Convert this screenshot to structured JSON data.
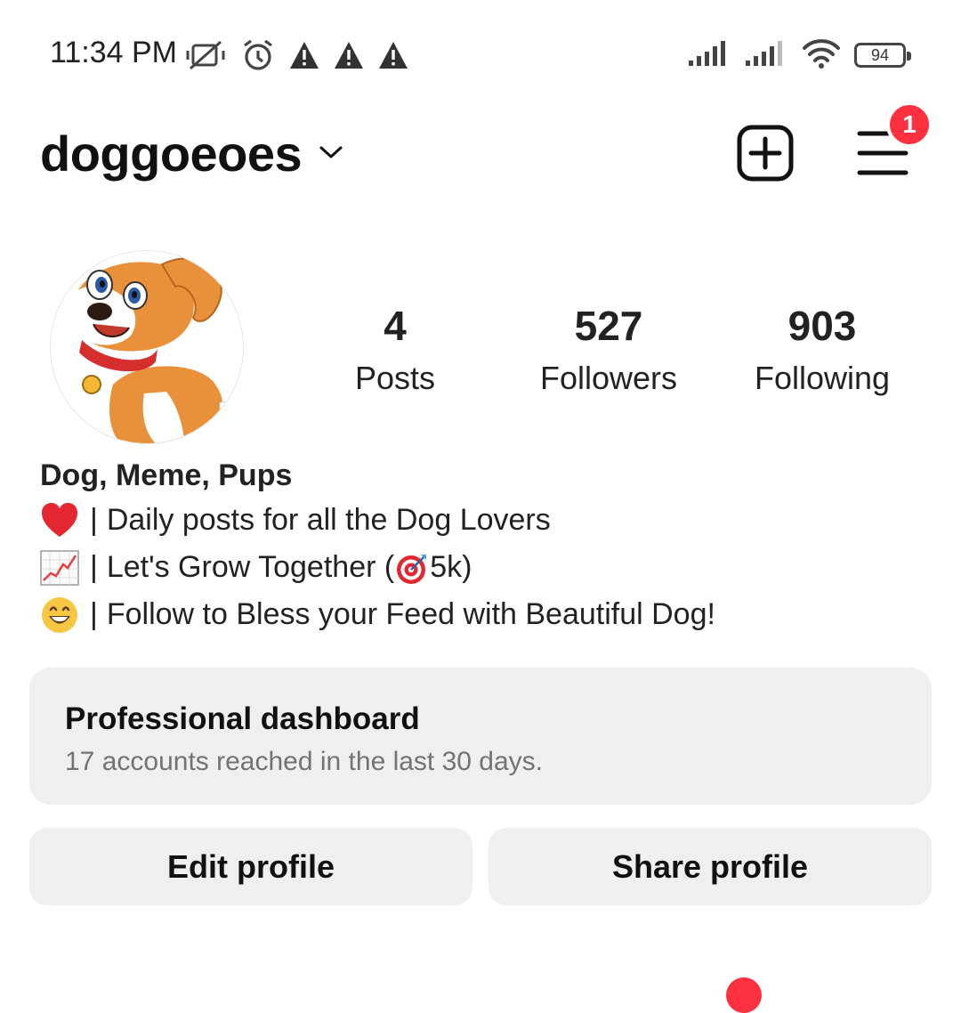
{
  "status_bar": {
    "time": "11:34 PM",
    "battery_level": "94",
    "left_icons": [
      "vibrate-off-icon",
      "alarm-icon",
      "warning-icon",
      "warning-icon",
      "warning-icon"
    ],
    "right_icons": [
      "signal-icon",
      "signal-icon",
      "wifi-icon",
      "battery-icon"
    ]
  },
  "header": {
    "username": "doggoeoes",
    "notification_count": "1"
  },
  "profile": {
    "stats": [
      {
        "value": "4",
        "label": "Posts"
      },
      {
        "value": "527",
        "label": "Followers"
      },
      {
        "value": "903",
        "label": "Following"
      }
    ],
    "bio_name": "Dog, Meme, Pups",
    "bio_lines": [
      {
        "emoji": "red-heart",
        "text": "Daily posts for all the Dog Lovers"
      },
      {
        "emoji": "chart-increasing",
        "text_before": "Let's Grow Together (",
        "inline_emoji": "target",
        "text_after": "5k)"
      },
      {
        "emoji": "grinning-face",
        "text": "Follow to Bless your Feed with Beautiful Dog!"
      }
    ],
    "separator": "|"
  },
  "dashboard": {
    "title": "Professional dashboard",
    "subtitle": "17 accounts reached in the last 30 days."
  },
  "actions": {
    "edit_label": "Edit profile",
    "share_label": "Share profile"
  },
  "colors": {
    "badge": "#ff3040",
    "button_bg": "#efefef",
    "muted_text": "#737373"
  }
}
